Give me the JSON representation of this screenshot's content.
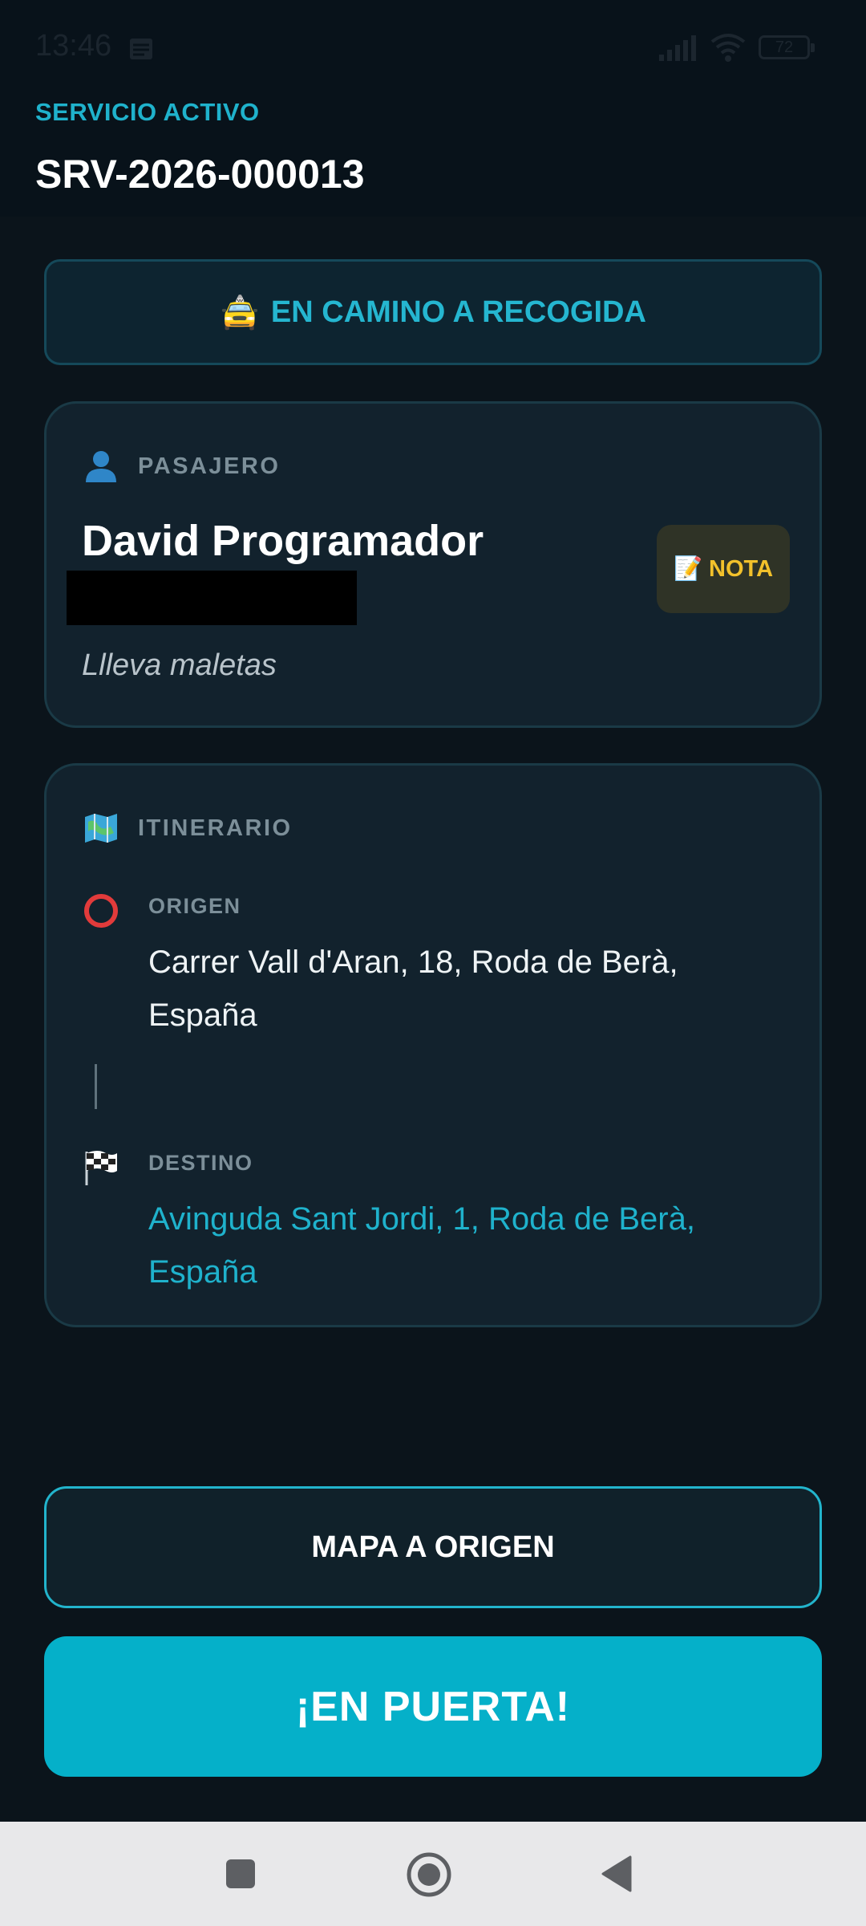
{
  "status_bar": {
    "time": "13:46",
    "battery": "72"
  },
  "header": {
    "section_label": "SERVICIO ACTIVO",
    "service_id": "SRV-2026-000013"
  },
  "status": {
    "icon": "taxi-emoji",
    "emoji": "🚖",
    "label": "EN CAMINO A RECOGIDA"
  },
  "passenger": {
    "heading": "PASAJERO",
    "heading_icon": "person-icon",
    "name": "David Programador",
    "note": "Llleva maletas",
    "note_button": {
      "emoji": "📝",
      "label": "NOTA"
    }
  },
  "itinerary": {
    "heading": "ITINERARIO",
    "heading_icon": "map-icon",
    "origin": {
      "label": "ORIGEN",
      "icon": "hollow-circle-icon",
      "address": "Carrer Vall d'Aran, 18, Roda de Berà, España"
    },
    "destination": {
      "label": "DESTINO",
      "icon": "checkered-flag-icon",
      "address": "Avinguda Sant Jordi, 1, Roda de Berà, España"
    }
  },
  "actions": {
    "map_button": "MAPA A ORIGEN",
    "primary_button": "¡EN PUERTA!"
  },
  "colors": {
    "accent": "#1fb2cc",
    "primary_button": "#05b0c9",
    "note_text": "#f2c12b",
    "background": "#0b141b"
  }
}
